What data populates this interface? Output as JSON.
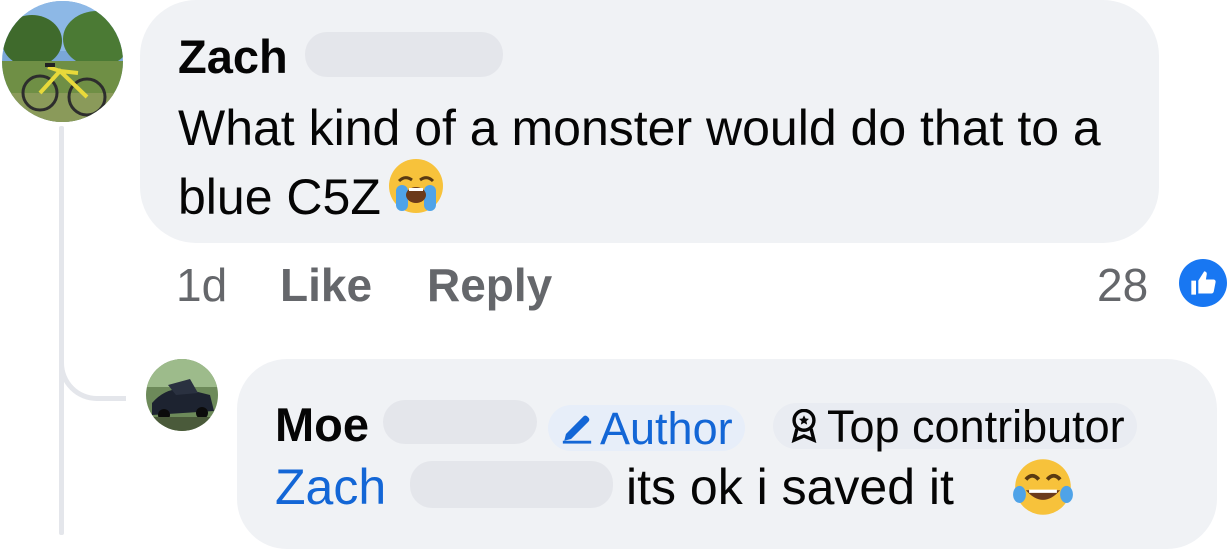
{
  "comment": {
    "author": "Zach",
    "text": "What kind of a monster would do that to a blue C5Z",
    "emoji": "loudly-crying-face-emoji",
    "timestamp": "1d",
    "like_label": "Like",
    "reply_label": "Reply",
    "reaction_count": "28",
    "reaction_icon": "thumbs-up-icon"
  },
  "reply": {
    "author": "Moe",
    "badges": [
      {
        "label": "Author",
        "icon": "pencil-icon"
      },
      {
        "label": "Top contributor",
        "icon": "award-ribbon-icon"
      }
    ],
    "mention": "Zach",
    "text": "its ok i saved it",
    "emoji": "tears-of-joy-emoji"
  },
  "colors": {
    "bubble": "#f0f2f5",
    "meta_text": "#65676b",
    "link_blue": "#1366d6",
    "like_blue": "#1877f2"
  }
}
